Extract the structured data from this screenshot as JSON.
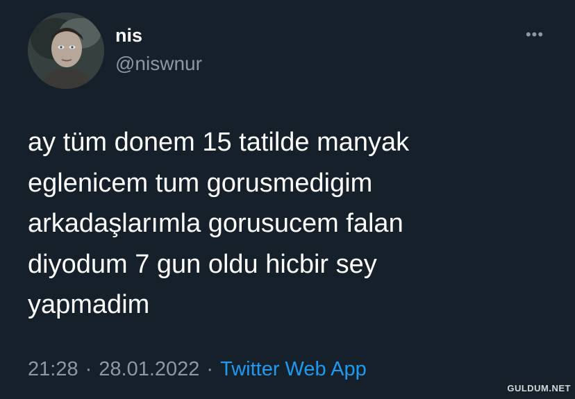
{
  "tweet": {
    "display_name": "nis",
    "handle": "@niswnur",
    "more_icon": "more-horizontal-icon",
    "text": "ay tüm donem 15 tatilde manyak\neglenicem tum gorusmedigim\narkadaşlarımla gorusucem falan\ndiyodum 7 gun oldu hicbir sey\nyapmadim",
    "time": "21:28",
    "separator": "·",
    "date": "28.01.2022",
    "source": "Twitter Web App"
  },
  "watermark": "GULDUM.NET",
  "colors": {
    "background": "#15202b",
    "text": "#ffffff",
    "secondary": "#8b98a5",
    "link": "#1d9bf0"
  }
}
